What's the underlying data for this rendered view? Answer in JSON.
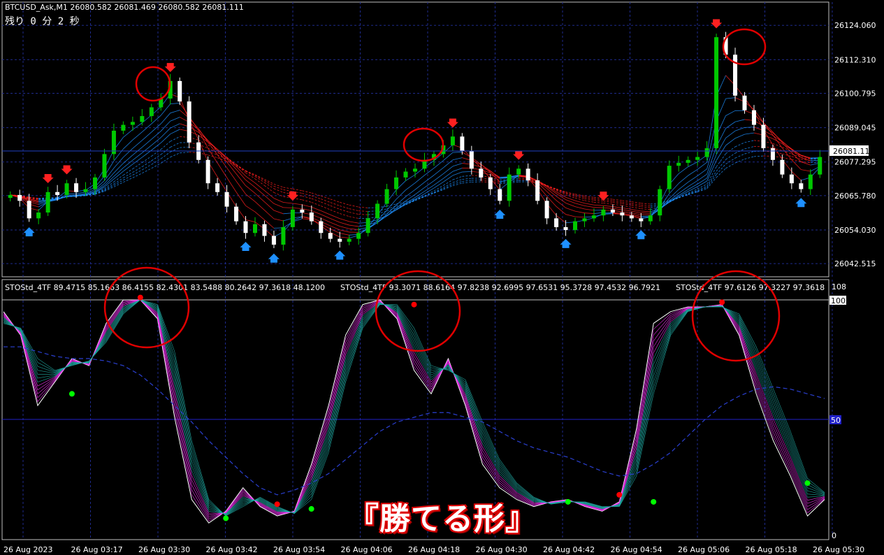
{
  "symbol_header": "BTCUSD_Ask,M1  26080.582 26081.469 26080.582 26081.111",
  "countdown": "残り 0 分 2 秒",
  "current_price": "26081.111",
  "price_axis": [
    "26124.060",
    "26112.310",
    "26100.795",
    "26089.045",
    "26077.295",
    "26065.780",
    "26054.030",
    "26042.515"
  ],
  "indicator_labels": [
    "STOStd_4TF 89.4715 85.1663 86.4155 82.4301 83.5488 80.2642 97.3618 48.1200",
    "STOStd_4TF 93.3071 88.6164 97.8238 92.6995 97.6531 95.3728 97.4532 96.7921",
    "STOStd_4TF 97.6126 97.3227 97.3618"
  ],
  "indicator_axis": {
    "top": "108",
    "upper": "100",
    "mid": "50",
    "bottom": "0"
  },
  "time_axis": [
    "26 Aug 2023",
    "26 Aug 03:17",
    "26 Aug 03:30",
    "26 Aug 03:42",
    "26 Aug 03:54",
    "26 Aug 04:06",
    "26 Aug 04:18",
    "26 Aug 04:30",
    "26 Aug 04:42",
    "26 Aug 04:54",
    "26 Aug 05:06",
    "26 Aug 05:18",
    "26 Aug 05:30"
  ],
  "banner_text": "『勝てる形』",
  "colors": {
    "bull": "#00c800",
    "bear": "#ffffff",
    "sell_arrow": "#ff2020",
    "buy_arrow": "#1e90ff",
    "grid": "#1e2a8c",
    "circle": "#e00000",
    "stoch_fast": "#ff33ff",
    "stoch_slow": "#20b2aa"
  },
  "chart_data": [
    {
      "type": "candlestick",
      "title": "BTCUSD_Ask,M1",
      "ylim": [
        26038,
        26132
      ],
      "x_ticks": [
        "26 Aug 2023",
        "26 Aug 03:17",
        "26 Aug 03:30",
        "26 Aug 03:42",
        "26 Aug 03:54",
        "26 Aug 04:06",
        "26 Aug 04:18",
        "26 Aug 04:30",
        "26 Aug 04:42",
        "26 Aug 04:54",
        "26 Aug 05:06",
        "26 Aug 05:18",
        "26 Aug 05:30"
      ],
      "close_path": [
        26066,
        26064,
        26058,
        26060,
        26067,
        26066,
        26070,
        26067,
        26068,
        26072,
        26080,
        26088,
        26090,
        26091,
        26093,
        26096,
        26099,
        26105,
        26098,
        26084,
        26078,
        26070,
        26067,
        26062,
        26057,
        26053,
        26056,
        26052,
        26049,
        26055,
        26061,
        26060,
        26057,
        26053,
        26051,
        26050,
        26051,
        26053,
        26058,
        26063,
        26068,
        26072,
        26074,
        26075,
        26078,
        26080,
        26083,
        26086,
        26081,
        26075,
        26072,
        26068,
        26064,
        26073,
        26075,
        26071,
        26064,
        26058,
        26055,
        26054,
        26057,
        26058,
        26059,
        26061,
        26060,
        26059,
        26058,
        26057,
        26059,
        26068,
        26076,
        26077,
        26078,
        26079,
        26082,
        26120,
        26114,
        26100,
        26095,
        26090,
        26082,
        26078,
        26073,
        26070,
        26068,
        26073,
        26079
      ],
      "ma_ribbon_up_color": "#1e90ff",
      "ma_ribbon_down_color": "#ff2020"
    },
    {
      "type": "line",
      "title": "STOStd_4TF",
      "ylim": [
        0,
        108
      ],
      "reference_levels": [
        100,
        50
      ],
      "x": [
        0,
        1,
        2,
        3,
        4,
        5,
        6,
        7,
        8,
        9,
        10,
        11,
        12,
        13,
        14,
        15,
        16,
        17,
        18,
        19,
        20,
        21,
        22,
        23,
        24,
        25,
        26,
        27,
        28,
        29,
        30,
        31,
        32,
        33,
        34,
        35,
        36,
        37,
        38,
        39,
        40,
        41,
        42,
        43,
        44,
        45,
        46,
        47,
        48
      ],
      "series": [
        {
          "values": [
            95,
            85,
            55,
            65,
            75,
            72,
            90,
            100,
            100,
            92,
            50,
            15,
            5,
            10,
            20,
            12,
            8,
            10,
            30,
            55,
            85,
            98,
            100,
            92,
            70,
            60,
            75,
            55,
            30,
            20,
            15,
            12,
            14,
            15,
            12,
            10,
            14,
            45,
            90,
            95,
            97,
            97,
            98,
            85,
            60,
            40,
            25,
            8,
            15
          ]
        },
        {
          "values": [
            90,
            88,
            75,
            70,
            72,
            74,
            82,
            94,
            100,
            98,
            78,
            40,
            15,
            8,
            12,
            16,
            12,
            9,
            15,
            35,
            65,
            88,
            98,
            98,
            88,
            72,
            70,
            66,
            48,
            32,
            22,
            16,
            13,
            14,
            14,
            12,
            12,
            25,
            60,
            85,
            95,
            97,
            97,
            94,
            80,
            62,
            44,
            24,
            18
          ]
        }
      ],
      "signal_line": {
        "values": [
          80,
          80,
          78,
          76,
          75,
          75,
          74,
          72,
          68,
          62,
          55,
          48,
          40,
          33,
          26,
          20,
          17,
          19,
          22,
          26,
          32,
          38,
          44,
          48,
          50,
          52,
          52,
          50,
          48,
          44,
          40,
          37,
          35,
          33,
          30,
          27,
          25,
          26,
          30,
          35,
          42,
          49,
          55,
          59,
          62,
          63,
          62,
          60,
          58
        ]
      },
      "markers": [
        {
          "type": "buy",
          "x": 4,
          "y": 60
        },
        {
          "type": "sell",
          "x": 8,
          "y": 101
        },
        {
          "type": "buy",
          "x": 13,
          "y": 7
        },
        {
          "type": "sell",
          "x": 16,
          "y": 13
        },
        {
          "type": "buy",
          "x": 18,
          "y": 11
        },
        {
          "type": "sell",
          "x": 24,
          "y": 98
        },
        {
          "type": "buy",
          "x": 33,
          "y": 14
        },
        {
          "type": "sell",
          "x": 36,
          "y": 17
        },
        {
          "type": "buy",
          "x": 38,
          "y": 14
        },
        {
          "type": "sell",
          "x": 42,
          "y": 99
        },
        {
          "type": "buy",
          "x": 47,
          "y": 22
        }
      ]
    }
  ]
}
